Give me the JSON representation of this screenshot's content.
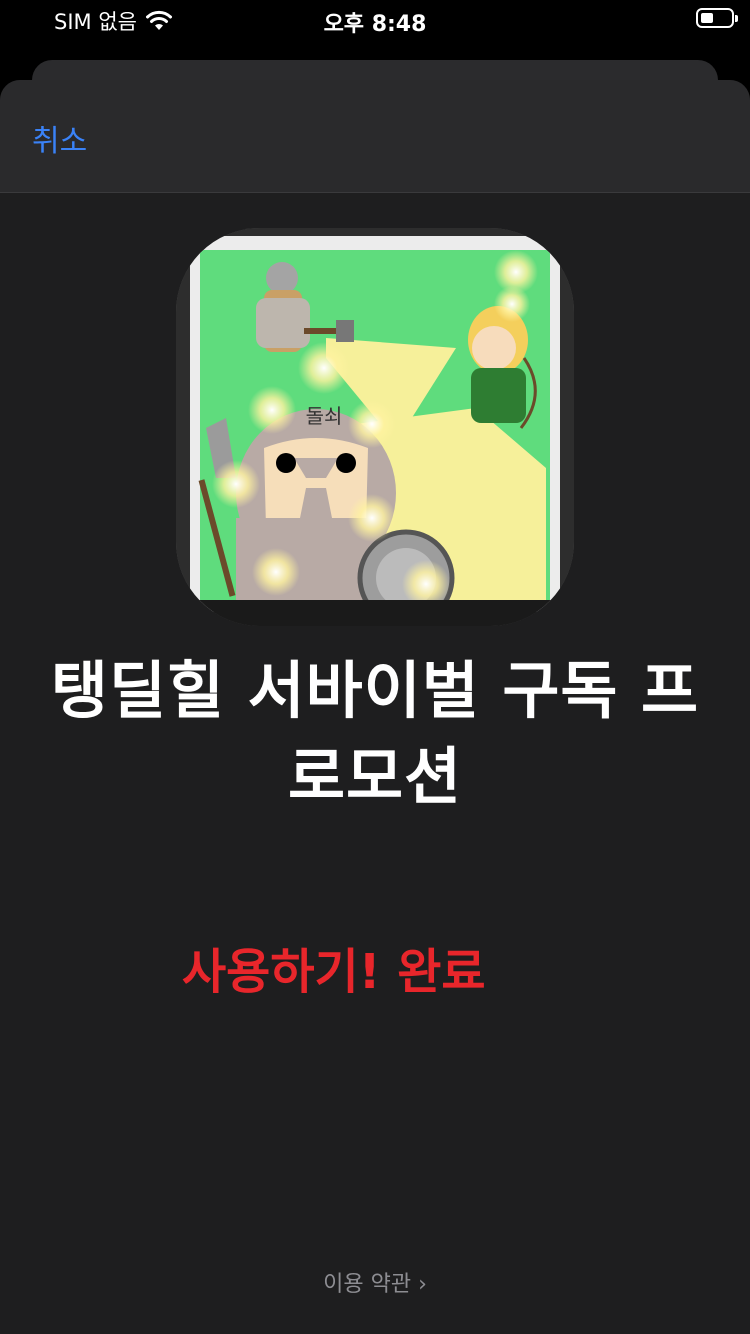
{
  "status_bar": {
    "carrier": "SIM 없음",
    "time": "오후 8:48"
  },
  "header": {
    "cancel_label": "취소"
  },
  "app_icon": {
    "overlay_label": "돌쇠"
  },
  "promo": {
    "title_line1": "탱딜힐 서바이벌 구독 프",
    "title_line2": "로모션",
    "status_message": "사용하기! 완료"
  },
  "footer": {
    "terms_label": "이용 약관 ›"
  }
}
